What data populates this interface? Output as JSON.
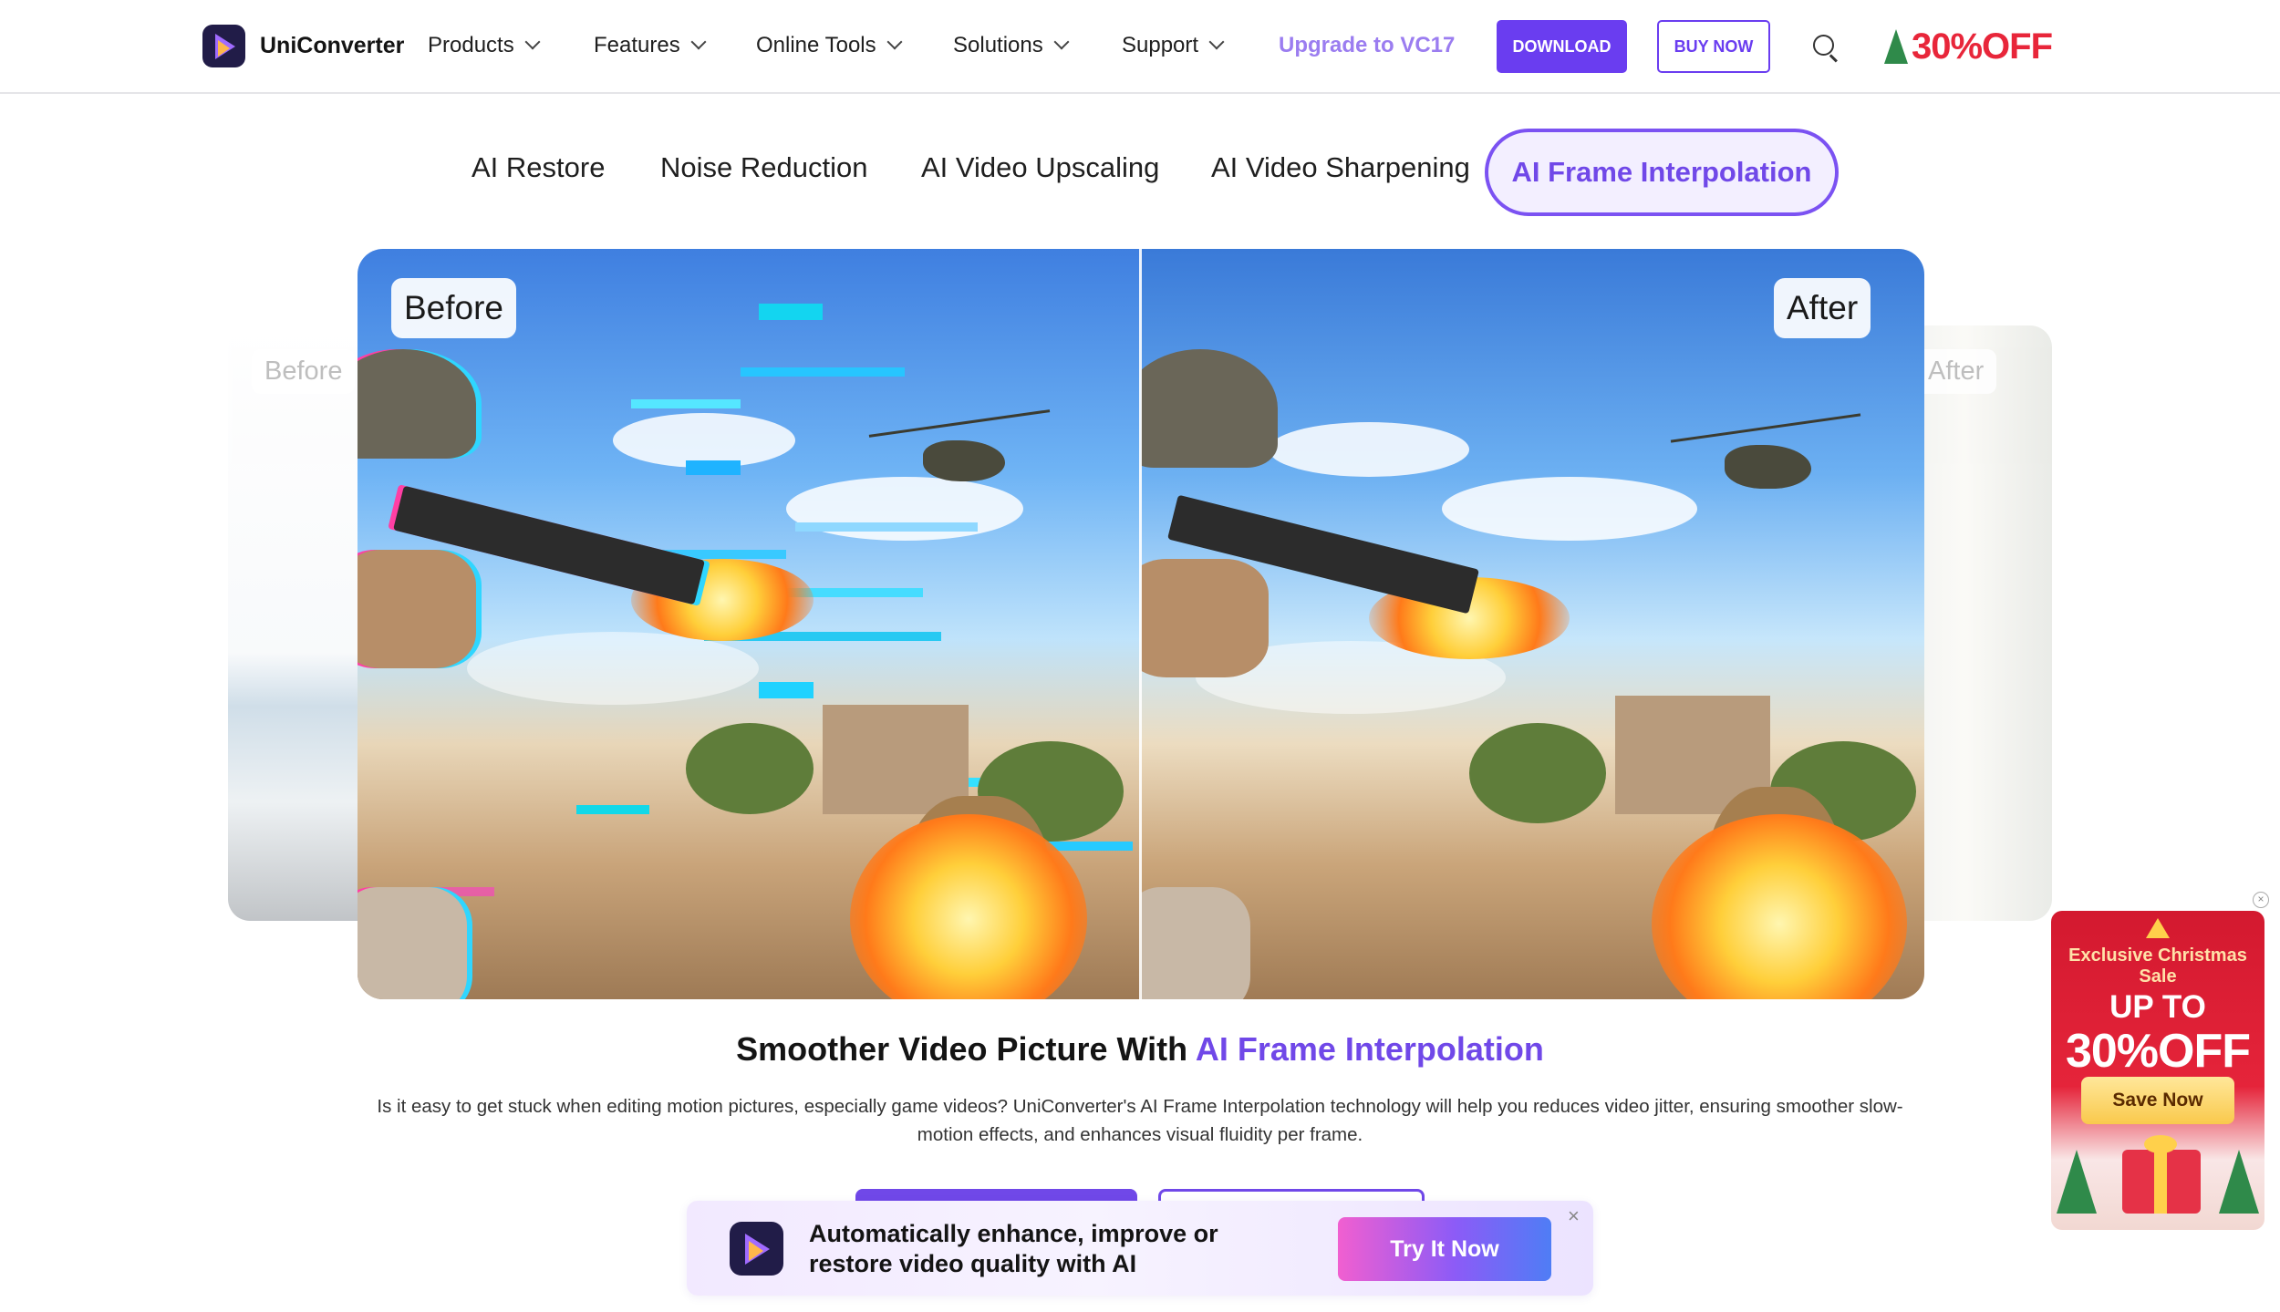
{
  "header": {
    "brand": "UniConverter",
    "nav": [
      "Products",
      "Features",
      "Online Tools",
      "Solutions",
      "Support"
    ],
    "upgrade_link": "Upgrade to VC17",
    "download_label": "DOWNLOAD",
    "buy_now_label": "BUY NOW",
    "promo_badge": "30%OFF"
  },
  "tabs": {
    "items": [
      "AI Restore",
      "Noise Reduction",
      "AI Video Upscaling",
      "AI Video Sharpening"
    ],
    "active": "AI Frame Interpolation"
  },
  "carousel": {
    "left_label": "Before",
    "right_label": "After",
    "before_label": "Before",
    "after_label": "After"
  },
  "content": {
    "headline_prefix": "Smoother Video Picture With ",
    "headline_highlight": "AI Frame Interpolation",
    "description": "Is it easy to get stuck when editing motion pictures, especially game videos? UniConverter's AI Frame Interpolation technology will help you reduces video jitter, ensuring smoother slow-motion effects, and enhances visual fluidity per frame."
  },
  "banner": {
    "text": "Automatically enhance, improve or restore video quality with AI",
    "button": "Try It Now",
    "close": "×"
  },
  "xmas_promo": {
    "line1": "Exclusive Christmas Sale",
    "line2": "UP TO",
    "discount": "30%OFF",
    "button": "Save Now",
    "close": "×"
  },
  "colors": {
    "accent": "#7048e8",
    "download_bg": "#6a3df0",
    "upgrade_text": "#9b7df0",
    "promo_red": "#e8263a"
  },
  "icons": [
    "uniconverter-logo-icon",
    "chevron-down-icon",
    "search-icon",
    "christmas-tree-icon",
    "close-icon"
  ]
}
